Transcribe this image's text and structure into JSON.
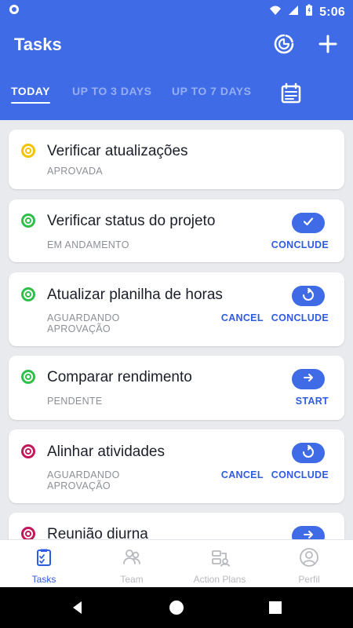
{
  "status_bar": {
    "time": "5:06"
  },
  "header": {
    "title": "Tasks",
    "tabs": [
      {
        "label": "TODAY",
        "active": true
      },
      {
        "label": "UP TO 3 DAYS",
        "active": false
      },
      {
        "label": "UP TO 7 DAYS",
        "active": false
      }
    ],
    "icons": [
      "pie-chart-icon",
      "plus-icon",
      "calendar-icon"
    ]
  },
  "tasks": [
    {
      "title": "Verificar atualizações",
      "status": "APROVADA",
      "ring_color": "#f2c400",
      "pill_icon": "",
      "actions": []
    },
    {
      "title": "Verificar status do projeto",
      "status": "EM ANDAMENTO",
      "ring_color": "#2fbf4a",
      "pill_icon": "check-icon",
      "actions": [
        "CONCLUDE"
      ]
    },
    {
      "title": "Atualizar planilha de horas",
      "status": "AGUARDANDO\nAPROVAÇÃO",
      "ring_color": "#2fbf4a",
      "pill_icon": "refresh-icon",
      "actions": [
        "CANCEL",
        "CONCLUDE"
      ]
    },
    {
      "title": "Comparar rendimento",
      "status": "PENDENTE",
      "ring_color": "#2fbf4a",
      "pill_icon": "arrow-right-icon",
      "actions": [
        "START"
      ]
    },
    {
      "title": "Alinhar atividades",
      "status": "AGUARDANDO\nAPROVAÇÃO",
      "ring_color": "#c2185b",
      "pill_icon": "refresh-icon",
      "actions": [
        "CANCEL",
        "CONCLUDE"
      ]
    },
    {
      "title": "Reunião diurna",
      "status": "",
      "ring_color": "#c2185b",
      "pill_icon": "arrow-right-icon",
      "actions": []
    }
  ],
  "bottom_nav": [
    {
      "label": "Tasks",
      "active": true,
      "icon": "tasks-icon"
    },
    {
      "label": "Team",
      "active": false,
      "icon": "team-icon"
    },
    {
      "label": "Action Plans",
      "active": false,
      "icon": "action-plans-icon"
    },
    {
      "label": "Perfil",
      "active": false,
      "icon": "profile-icon"
    }
  ],
  "colors": {
    "primary": "#3f6ce6",
    "background": "#e9eaee"
  }
}
